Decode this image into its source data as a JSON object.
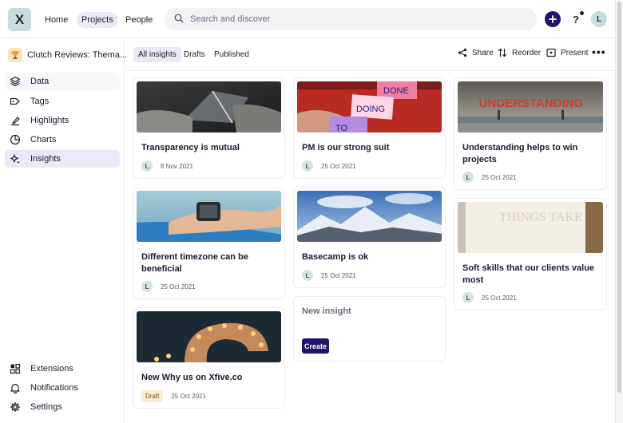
{
  "topbar": {
    "logo_letter": "X",
    "nav": [
      "Home",
      "Projects",
      "People"
    ],
    "search_placeholder": "Search and discover",
    "help_label": "?",
    "avatar_initial": "L"
  },
  "sidebar": {
    "project_name": "Clutch Reviews: Thema...",
    "items": [
      {
        "label": "Data",
        "icon": "layers-icon"
      },
      {
        "label": "Tags",
        "icon": "tag-icon"
      },
      {
        "label": "Highlights",
        "icon": "highlighter-icon"
      },
      {
        "label": "Charts",
        "icon": "pie-chart-icon"
      },
      {
        "label": "Insights",
        "icon": "sparkles-icon"
      }
    ],
    "bottom_items": [
      {
        "label": "Extensions",
        "icon": "extensions-icon"
      },
      {
        "label": "Notifications",
        "icon": "bell-icon"
      },
      {
        "label": "Settings",
        "icon": "gear-icon"
      }
    ]
  },
  "toolbar": {
    "tabs": [
      "All insights",
      "Drafts",
      "Published"
    ],
    "share": "Share",
    "reorder": "Reorder",
    "present": "Present"
  },
  "cards": [
    {
      "title": "Transparency is mutual",
      "avatar": "L",
      "date": "8 Nov 2021"
    },
    {
      "title": "PM is our strong suit",
      "avatar": "L",
      "date": "25 Oct 2021",
      "sticky_notes": [
        "DONE",
        "DOING",
        "TO"
      ]
    },
    {
      "title": "Understanding helps to win projects",
      "avatar": "L",
      "date": "25 Oct 2021",
      "image_text": "UNDERSTANDING"
    },
    {
      "title": "Different timezone can be beneficial",
      "avatar": "L",
      "date": "25 Oct 2021"
    },
    {
      "title": "Basecamp is ok",
      "avatar": "L",
      "date": "25 Oct 2021"
    },
    {
      "title": "Soft skills that our clients value most",
      "avatar": "L",
      "date": "25 Oct 2021",
      "image_text": "THINGS TAKE"
    },
    {
      "title": "New Why us on Xfive.co",
      "badge": "Draft",
      "date": "25 Oct 2021"
    }
  ],
  "new_insight": {
    "title": "New insight",
    "button": "Create"
  },
  "colors": {
    "accent": "#22146e",
    "active_bg": "#ece9f6",
    "logo_bg": "#c9dcdd"
  }
}
